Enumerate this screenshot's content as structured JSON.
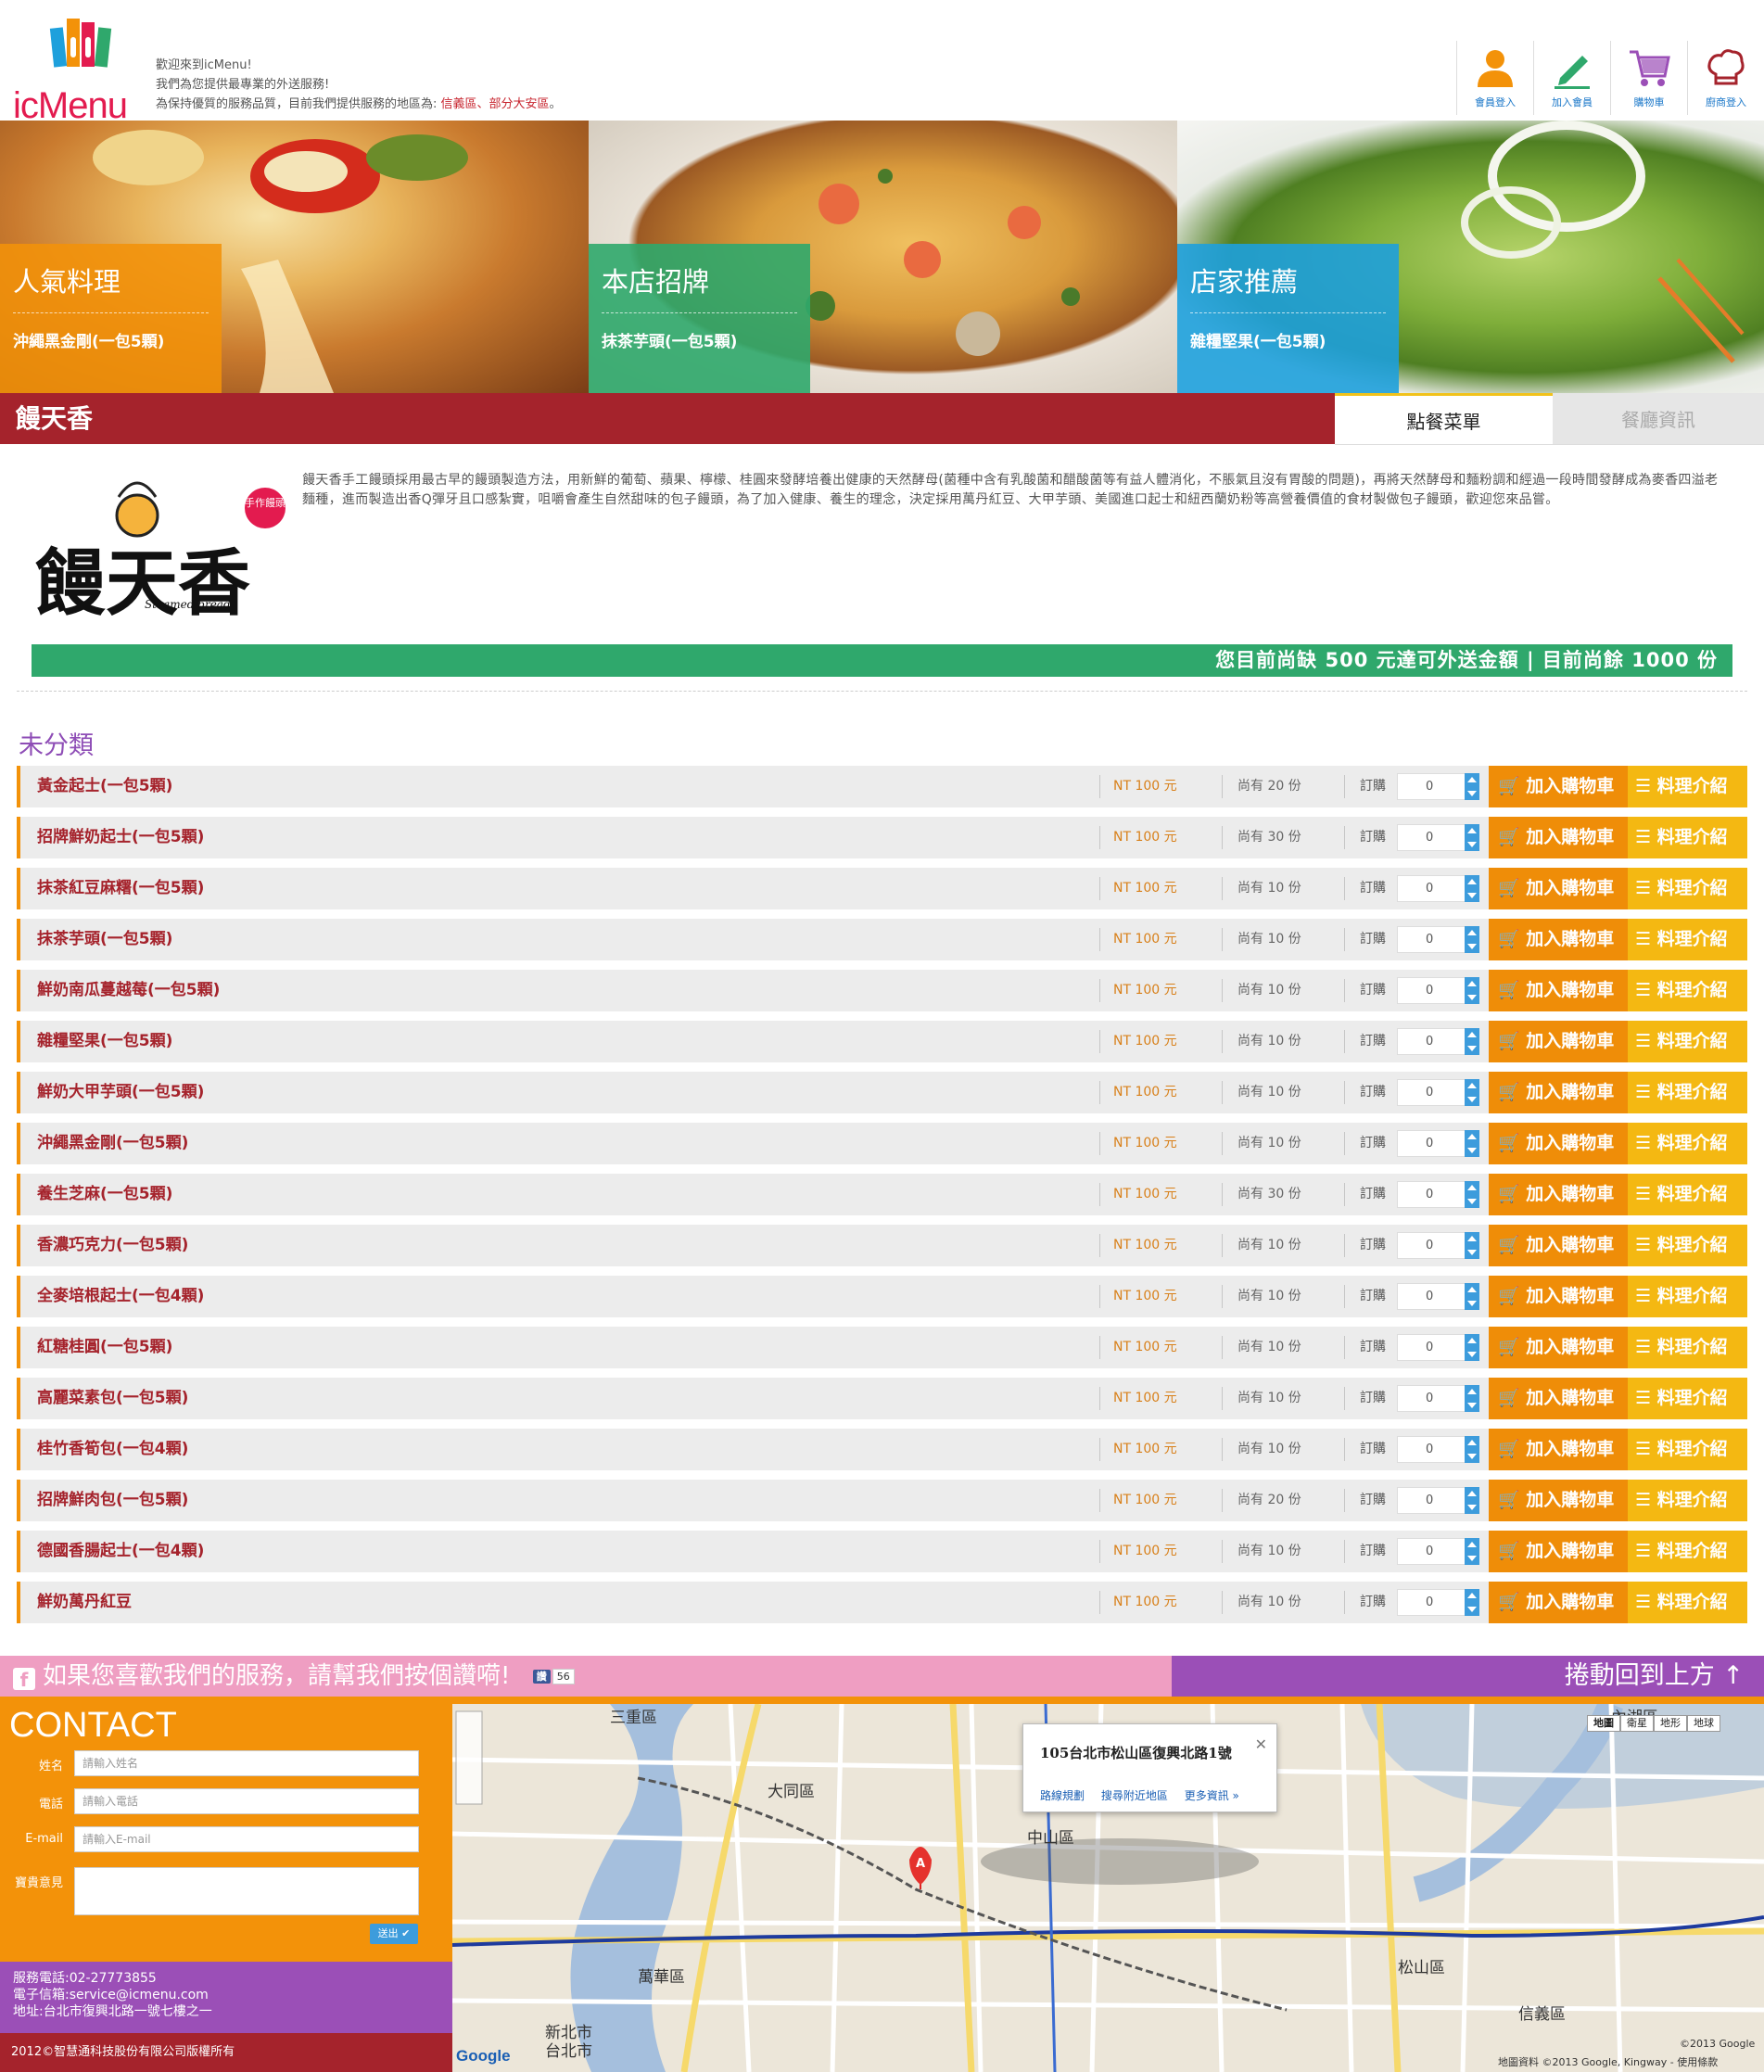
{
  "header": {
    "logo_text": "icMenu",
    "welcome_lines": [
      "歡迎來到icMenu!",
      "我們為您提供最專業的外送服務!"
    ],
    "welcome_line3_prefix": "為保持優質的服務品質，目前我們提供服務的地區為: ",
    "welcome_line3_areas": "信義區、部分大安區",
    "welcome_line3_suffix": "。",
    "nav": [
      {
        "label": "會員登入",
        "icon": "user-icon",
        "color": "#f39209"
      },
      {
        "label": "加入會員",
        "icon": "pencil-icon",
        "color": "#2fa86c"
      },
      {
        "label": "購物車",
        "icon": "cart-icon",
        "color": "#9b4fb7"
      },
      {
        "label": "廚商登入",
        "icon": "chef-hat-icon",
        "color": "#a5232c"
      }
    ]
  },
  "banners": [
    {
      "title": "人氣料理",
      "item": "沖繩黑金剛(一包5顆)",
      "color": "#f39209"
    },
    {
      "title": "本店招牌",
      "item": "抹茶芋頭(一包5顆)",
      "color": "#2fa86c"
    },
    {
      "title": "店家推薦",
      "item": "雜糧堅果(一包5顆)",
      "color": "#1ea0dc"
    }
  ],
  "store": {
    "name": "饅天香",
    "tabs": [
      "點餐菜單",
      "餐廳資訊"
    ],
    "logo_text": "饅天香",
    "logo_badge": "手作饅頭",
    "logo_sub": "Steamed bread",
    "description": "饅天香手工饅頭採用最古早的饅頭製造方法，用新鮮的葡萄、蘋果、檸檬、桂圓來發酵培養出健康的天然酵母(菌種中含有乳酸菌和醋酸菌等有益人體消化，不脹氣且沒有胃酸的問題)，再將天然酵母和麵粉調和經過一段時間發酵成為麥香四溢老麵種，進而製造出香Q彈牙且口感紮實，咀嚼會產生自然甜味的包子饅頭，為了加入健康、養生的理念，決定採用萬丹紅豆、大甲芋頭、美國進口起士和紐西蘭奶粉等高營養價值的食材製做包子饅頭，歡迎您來品嘗。",
    "alert": "您目前尚缺 500 元達可外送金額 | 目前尚餘 1000 份"
  },
  "menu": {
    "category": "未分類",
    "order_label": "訂購",
    "add_label": "加入購物車",
    "info_label": "料理介紹",
    "items": [
      {
        "name": "黃金起士(一包5顆)",
        "price": "NT 100 元",
        "stock": "尚有 20 份",
        "qty": "0"
      },
      {
        "name": "招牌鮮奶起士(一包5顆)",
        "price": "NT 100 元",
        "stock": "尚有 30 份",
        "qty": "0"
      },
      {
        "name": "抹茶紅豆麻糬(一包5顆)",
        "price": "NT 100 元",
        "stock": "尚有 10 份",
        "qty": "0"
      },
      {
        "name": "抹茶芋頭(一包5顆)",
        "price": "NT 100 元",
        "stock": "尚有 10 份",
        "qty": "0"
      },
      {
        "name": "鮮奶南瓜蔓越莓(一包5顆)",
        "price": "NT 100 元",
        "stock": "尚有 10 份",
        "qty": "0"
      },
      {
        "name": "雜糧堅果(一包5顆)",
        "price": "NT 100 元",
        "stock": "尚有 10 份",
        "qty": "0"
      },
      {
        "name": "鮮奶大甲芋頭(一包5顆)",
        "price": "NT 100 元",
        "stock": "尚有 10 份",
        "qty": "0"
      },
      {
        "name": "沖繩黑金剛(一包5顆)",
        "price": "NT 100 元",
        "stock": "尚有 10 份",
        "qty": "0"
      },
      {
        "name": "養生芝麻(一包5顆)",
        "price": "NT 100 元",
        "stock": "尚有 30 份",
        "qty": "0"
      },
      {
        "name": "香濃巧克力(一包5顆)",
        "price": "NT 100 元",
        "stock": "尚有 10 份",
        "qty": "0"
      },
      {
        "name": "全麥培根起士(一包4顆)",
        "price": "NT 100 元",
        "stock": "尚有 10 份",
        "qty": "0"
      },
      {
        "name": "紅糖桂圓(一包5顆)",
        "price": "NT 100 元",
        "stock": "尚有 10 份",
        "qty": "0"
      },
      {
        "name": "高麗菜素包(一包5顆)",
        "price": "NT 100 元",
        "stock": "尚有 10 份",
        "qty": "0"
      },
      {
        "name": "桂竹香筍包(一包4顆)",
        "price": "NT 100 元",
        "stock": "尚有 10 份",
        "qty": "0"
      },
      {
        "name": "招牌鮮肉包(一包5顆)",
        "price": "NT 100 元",
        "stock": "尚有 20 份",
        "qty": "0"
      },
      {
        "name": "德國香腸起士(一包4顆)",
        "price": "NT 100 元",
        "stock": "尚有 10 份",
        "qty": "0"
      },
      {
        "name": "鮮奶萬丹紅豆",
        "price": "NT 100 元",
        "stock": "尚有 10 份",
        "qty": "0"
      }
    ]
  },
  "footer": {
    "fb_text": "如果您喜歡我們的服務，請幫我們按個讚嗬!",
    "fb_like": "讚",
    "fb_count": "56",
    "back_to_top": "捲動回到上方",
    "contact_title": "CONTACT",
    "fields": [
      {
        "label": "姓名",
        "placeholder": "請輸入姓名"
      },
      {
        "label": "電話",
        "placeholder": "請輸入電話"
      },
      {
        "label": "E-mail",
        "placeholder": "請輸入E-mail"
      }
    ],
    "feedback_label": "寶貴意見",
    "send_label": "送出",
    "phone": "服務電話:02-27773855",
    "email": "電子信箱:service@icmenu.com",
    "address": "地址:台北市復興北路一號七樓之一",
    "copyright": "2012©智慧通科技股份有限公司版權所有"
  },
  "map": {
    "popup_address": "105台北市松山區復興北路1號",
    "popup_links": [
      "路線規劃",
      "搜尋附近地區",
      "更多資訊 »"
    ],
    "types": [
      "地圖",
      "衛星",
      "地形",
      "地球"
    ],
    "marker": "A",
    "labels": [
      "三重區",
      "大同區",
      "中山區",
      "內湖區",
      "松山區",
      "信義區",
      "萬華區",
      "新北市",
      "台北市"
    ],
    "copyright": "©2013 Google",
    "attribution": "地圖資料 ©2013 Google, Kingway - 使用條款",
    "google": "Google"
  }
}
